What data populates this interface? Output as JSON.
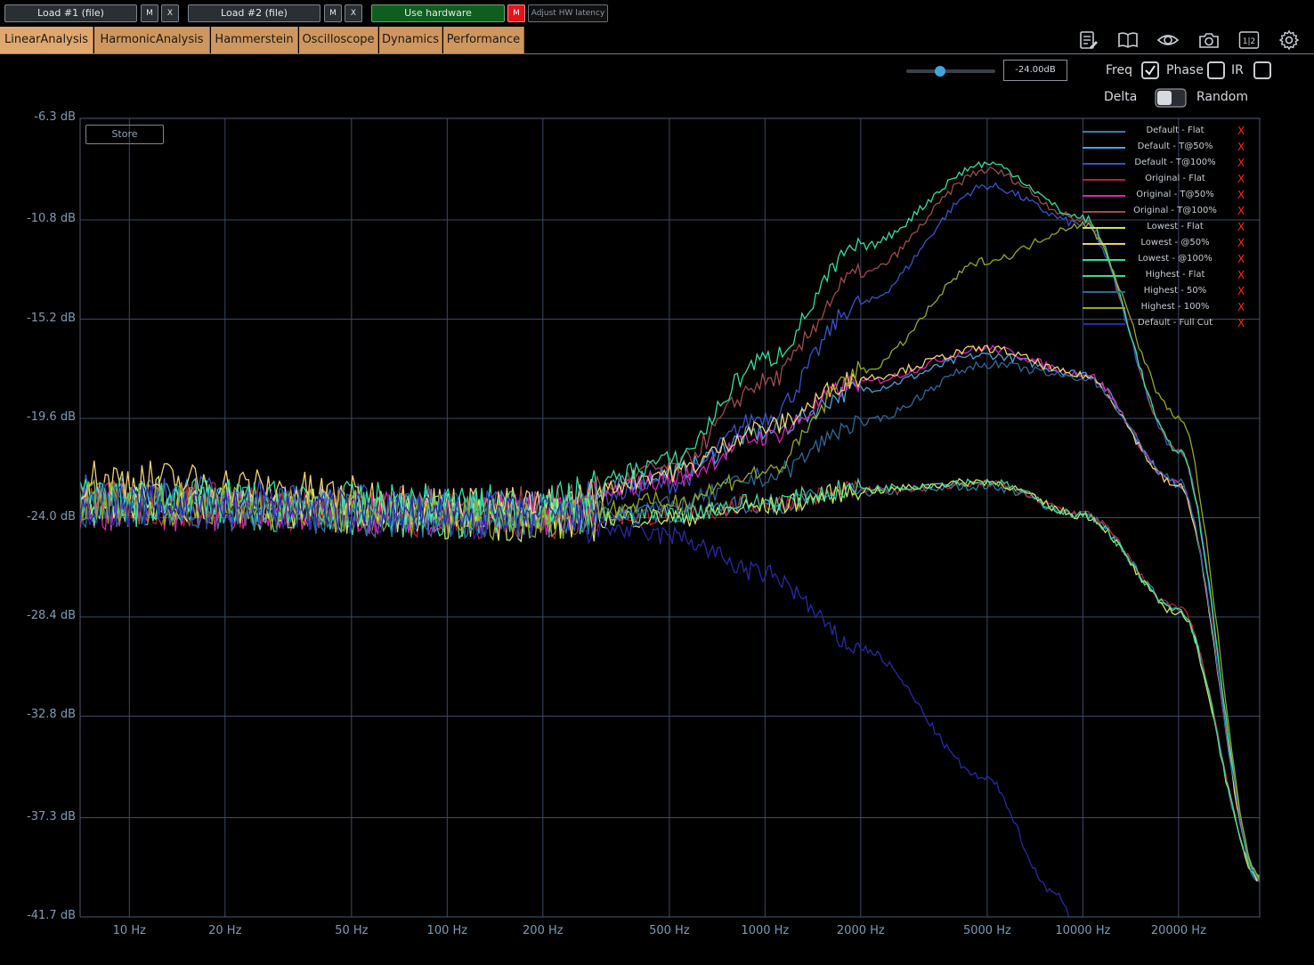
{
  "toolbar": {
    "load1_label": "Load #1 (file)",
    "load1_mute": "M",
    "load1_close": "X",
    "load2_label": "Load #2 (file)",
    "load2_mute": "M",
    "load2_close": "X",
    "use_hardware_label": "Use hardware",
    "hw_mute": "M",
    "adjust_latency_label": "Adjust HW latency"
  },
  "tabs": [
    {
      "label": "LinearAnalysis",
      "active": true
    },
    {
      "label": "HarmonicAnalysis",
      "active": false
    },
    {
      "label": "Hammerstein",
      "active": false
    },
    {
      "label": "Oscilloscope",
      "active": false
    },
    {
      "label": "Dynamics",
      "active": false
    },
    {
      "label": "Performance",
      "active": false
    }
  ],
  "tool_icons": [
    "notes-icon",
    "book-icon",
    "eye-icon",
    "camera-icon",
    "split-1-2-icon",
    "gear-icon"
  ],
  "split_icon_text": "1|2",
  "controls": {
    "level_value": "-24.00dB",
    "level_slider_fraction": 0.38,
    "freq_label": "Freq",
    "freq_checked": true,
    "phase_label": "Phase",
    "phase_checked": false,
    "ir_label": "IR",
    "ir_checked": false,
    "delta_label": "Delta",
    "delta_on": false,
    "random_label": "Random"
  },
  "store_label": "Store",
  "legend": [
    {
      "name": "Default - Flat",
      "color": "#2e7fb0",
      "close": "X"
    },
    {
      "name": "Default - T@50%",
      "color": "#3fa7e0",
      "close": "X"
    },
    {
      "name": "Default - T@100%",
      "color": "#3a52c8",
      "close": "X"
    },
    {
      "name": "Original - Flat",
      "color": "#b8203a",
      "close": "X"
    },
    {
      "name": "Original - T@50%",
      "color": "#e020b8",
      "close": "X"
    },
    {
      "name": "Original - T@100%",
      "color": "#a04a50",
      "close": "X"
    },
    {
      "name": "Lowest - Flat",
      "color": "#c8e860",
      "close": "X"
    },
    {
      "name": "Lowest - @50%",
      "color": "#f0d070",
      "close": "X"
    },
    {
      "name": "Lowest - @100%",
      "color": "#30e0a0",
      "close": "X"
    },
    {
      "name": "Highest - Flat",
      "color": "#40d898",
      "close": "X"
    },
    {
      "name": "Highest - 50%",
      "color": "#2a6a9a",
      "close": "X"
    },
    {
      "name": "Highest - 100%",
      "color": "#98a820",
      "close": "X"
    },
    {
      "name": "Default - Full Cut",
      "color": "#2828a8",
      "close": "X"
    }
  ],
  "chart_data": {
    "type": "line",
    "x_scale": "log",
    "xlim": [
      7,
      36000
    ],
    "ylim": [
      -41.7,
      -6.3
    ],
    "y_ticks": [
      "-6.3 dB",
      "-10.8 dB",
      "-15.2 dB",
      "-19.6 dB",
      "-24.0 dB",
      "-28.4 dB",
      "-32.8 dB",
      "-37.3 dB",
      "-41.7 dB"
    ],
    "y_tick_values": [
      -6.3,
      -10.8,
      -15.2,
      -19.6,
      -24.0,
      -28.4,
      -32.8,
      -37.3,
      -41.7
    ],
    "x_ticks": [
      "10 Hz",
      "20 Hz",
      "50 Hz",
      "100 Hz",
      "200 Hz",
      "500 Hz",
      "1000 Hz",
      "2000 Hz",
      "5000 Hz",
      "10000 Hz",
      "20000 Hz"
    ],
    "x_tick_values": [
      10,
      20,
      50,
      100,
      200,
      500,
      1000,
      2000,
      5000,
      10000,
      20000
    ],
    "grid": true,
    "legend_position": "top-right",
    "series": [
      {
        "name": "Default - Flat",
        "x": [
          7,
          200,
          500,
          1000,
          2000,
          5000,
          10000,
          20000,
          36000
        ],
        "y": [
          -23.5,
          -24.0,
          -23.8,
          -23.4,
          -22.9,
          -22.6,
          -23.9,
          -28.0,
          -40.0
        ]
      },
      {
        "name": "Default - T@50%",
        "x": [
          7,
          200,
          500,
          1000,
          2000,
          5000,
          10000,
          20000,
          36000
        ],
        "y": [
          -23.2,
          -23.8,
          -22.0,
          -20.2,
          -18.3,
          -16.8,
          -17.6,
          -22.5,
          -40.0
        ]
      },
      {
        "name": "Default - T@100%",
        "x": [
          7,
          200,
          500,
          1000,
          2000,
          5000,
          10000,
          20000,
          36000
        ],
        "y": [
          -23.0,
          -23.7,
          -22.5,
          -19.5,
          -14.5,
          -9.3,
          -11.0,
          -21.0,
          -40.0
        ]
      },
      {
        "name": "Original - Flat",
        "x": [
          7,
          200,
          500,
          1000,
          2000,
          5000,
          10000,
          20000,
          36000
        ],
        "y": [
          -23.3,
          -24.0,
          -23.9,
          -23.4,
          -22.8,
          -22.5,
          -23.8,
          -28.0,
          -40.0
        ]
      },
      {
        "name": "Original - T@50%",
        "x": [
          7,
          200,
          500,
          1000,
          2000,
          5000,
          10000,
          20000,
          36000
        ],
        "y": [
          -23.6,
          -23.8,
          -22.3,
          -20.4,
          -18.0,
          -16.5,
          -17.6,
          -22.5,
          -40.0
        ]
      },
      {
        "name": "Original - T@100%",
        "x": [
          7,
          200,
          500,
          1000,
          2000,
          5000,
          10000,
          20000,
          36000
        ],
        "y": [
          -23.4,
          -23.6,
          -21.8,
          -18.0,
          -13.2,
          -8.6,
          -10.8,
          -21.0,
          -40.0
        ]
      },
      {
        "name": "Lowest - Flat",
        "x": [
          7,
          200,
          500,
          1000,
          2000,
          5000,
          10000,
          20000,
          36000
        ],
        "y": [
          -23.1,
          -24.1,
          -24.0,
          -23.5,
          -22.8,
          -22.4,
          -23.9,
          -28.2,
          -40.0
        ]
      },
      {
        "name": "Lowest - @50%",
        "x": [
          7,
          200,
          500,
          1000,
          2000,
          5000,
          10000,
          20000,
          36000
        ],
        "y": [
          -22.3,
          -23.6,
          -22.0,
          -20.0,
          -17.8,
          -16.5,
          -17.7,
          -22.6,
          -40.0
        ]
      },
      {
        "name": "Lowest - @100%",
        "x": [
          7,
          200,
          500,
          1000,
          2000,
          5000,
          10000,
          20000,
          36000
        ],
        "y": [
          -23.2,
          -23.5,
          -21.5,
          -17.0,
          -12.0,
          -8.3,
          -10.7,
          -21.0,
          -40.0
        ]
      },
      {
        "name": "Highest - Flat",
        "x": [
          7,
          200,
          500,
          1000,
          2000,
          5000,
          10000,
          20000,
          36000
        ],
        "y": [
          -23.4,
          -24.0,
          -23.8,
          -23.3,
          -22.7,
          -22.4,
          -23.9,
          -28.1,
          -40.0
        ]
      },
      {
        "name": "Highest - 50%",
        "x": [
          7,
          200,
          500,
          1000,
          2000,
          5000,
          10000,
          20000,
          36000
        ],
        "y": [
          -23.5,
          -24.0,
          -23.5,
          -22.2,
          -19.8,
          -17.2,
          -17.8,
          -22.4,
          -40.0
        ]
      },
      {
        "name": "Highest - 100%",
        "x": [
          7,
          200,
          500,
          1000,
          2000,
          5000,
          10000,
          20000,
          36000
        ],
        "y": [
          -23.3,
          -24.0,
          -23.3,
          -22.0,
          -17.5,
          -12.6,
          -11.0,
          -19.5,
          -40.0
        ]
      },
      {
        "name": "Default - Full Cut",
        "x": [
          7,
          200,
          500,
          1000,
          2000,
          5000,
          8000,
          10000
        ],
        "y": [
          -23.4,
          -24.0,
          -24.8,
          -26.5,
          -29.8,
          -35.6,
          -40.5,
          -42.5
        ]
      }
    ]
  }
}
